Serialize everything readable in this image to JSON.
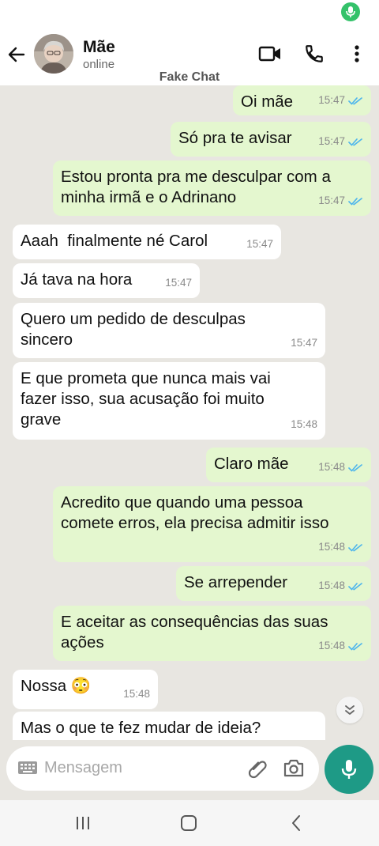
{
  "header": {
    "contact_name": "Mãe",
    "status": "online",
    "watermark": "Fake Chat"
  },
  "messages": [
    {
      "dir": "out",
      "lines": [
        "Oi mãe"
      ],
      "time": "15:47",
      "read": true
    },
    {
      "dir": "out",
      "lines": [
        "Só pra te avisar"
      ],
      "time": "15:47",
      "read": true
    },
    {
      "dir": "out",
      "lines": [
        "Estou pronta pra me desculpar com a",
        "minha irmã e o Adrinano"
      ],
      "time": "15:47",
      "read": true
    },
    {
      "dir": "in",
      "lines": [
        "Aaah  finalmente né Carol"
      ],
      "time": "15:47"
    },
    {
      "dir": "in",
      "lines": [
        "Já tava na hora"
      ],
      "time": "15:47"
    },
    {
      "dir": "in",
      "lines": [
        "Quero um pedido de desculpas",
        "sincero"
      ],
      "time": "15:47"
    },
    {
      "dir": "in",
      "lines": [
        "E que prometa que nunca mais vai",
        "fazer isso, sua acusação foi muito",
        "grave"
      ],
      "time": "15:48"
    },
    {
      "dir": "out",
      "lines": [
        "Claro mãe"
      ],
      "time": "15:48",
      "read": true
    },
    {
      "dir": "out",
      "lines": [
        "Acredito que quando uma pessoa",
        "comete erros, ela precisa admitir isso"
      ],
      "time": "15:48",
      "read": true
    },
    {
      "dir": "out",
      "lines": [
        "Se arrepender"
      ],
      "time": "15:48",
      "read": true
    },
    {
      "dir": "out",
      "lines": [
        "E aceitar as consequências das suas",
        "ações"
      ],
      "time": "15:48",
      "read": true
    },
    {
      "dir": "in",
      "lines": [
        "Nossa 😳"
      ],
      "time": "15:48"
    },
    {
      "dir": "in",
      "lines": [
        "Mas o que te fez mudar de ideia?"
      ],
      "time": ""
    }
  ],
  "compose": {
    "placeholder": "Mensagem"
  },
  "colors": {
    "outgoing_bubble": "#e4f7cf",
    "incoming_bubble": "#ffffff",
    "chat_background": "#e8e6e1",
    "read_tick": "#4fb6ec",
    "accent": "#1e9a86"
  },
  "icons": [
    "back-arrow-icon",
    "video-call-icon",
    "phone-icon",
    "more-options-icon",
    "keyboard-icon",
    "attach-icon",
    "camera-icon",
    "mic-icon",
    "double-chevron-down-icon"
  ]
}
